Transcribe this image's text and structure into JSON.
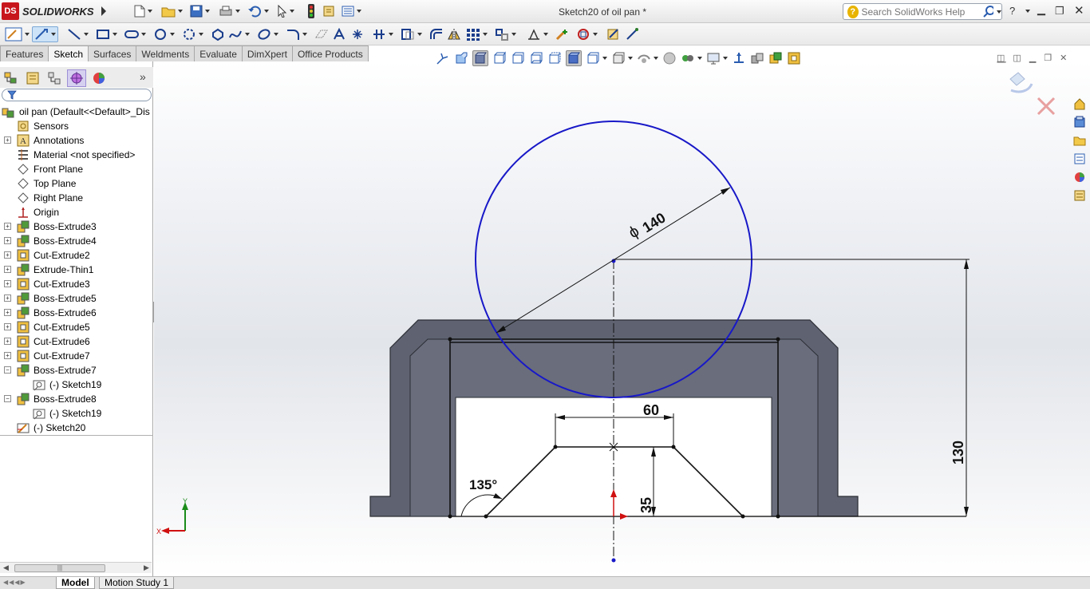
{
  "app": {
    "brand": "SOLIDWORKS",
    "logo_text": "DS"
  },
  "document": {
    "title": "Sketch20 of oil pan *"
  },
  "search": {
    "placeholder": "Search SolidWorks Help"
  },
  "tabs": [
    {
      "label": "Features",
      "active": false
    },
    {
      "label": "Sketch",
      "active": true
    },
    {
      "label": "Surfaces",
      "active": false
    },
    {
      "label": "Weldments",
      "active": false
    },
    {
      "label": "Evaluate",
      "active": false
    },
    {
      "label": "DimXpert",
      "active": false
    },
    {
      "label": "Office Products",
      "active": false
    }
  ],
  "tree": {
    "root": "oil pan  (Default<<Default>_Dis",
    "items": [
      {
        "label": "Sensors",
        "icon": "sensor-icon",
        "expandable": false,
        "level": 1
      },
      {
        "label": "Annotations",
        "icon": "annotations-icon",
        "expandable": true,
        "level": 1
      },
      {
        "label": "Material <not specified>",
        "icon": "material-icon",
        "expandable": false,
        "level": 1
      },
      {
        "label": "Front Plane",
        "icon": "plane-icon",
        "expandable": false,
        "level": 1
      },
      {
        "label": "Top Plane",
        "icon": "plane-icon",
        "expandable": false,
        "level": 1
      },
      {
        "label": "Right Plane",
        "icon": "plane-icon",
        "expandable": false,
        "level": 1
      },
      {
        "label": "Origin",
        "icon": "origin-icon",
        "expandable": false,
        "level": 1
      },
      {
        "label": "Boss-Extrude3",
        "icon": "boss-extrude-icon",
        "expandable": true,
        "level": 1
      },
      {
        "label": "Boss-Extrude4",
        "icon": "boss-extrude-icon",
        "expandable": true,
        "level": 1
      },
      {
        "label": "Cut-Extrude2",
        "icon": "cut-extrude-icon",
        "expandable": true,
        "level": 1
      },
      {
        "label": "Extrude-Thin1",
        "icon": "boss-extrude-icon",
        "expandable": true,
        "level": 1
      },
      {
        "label": "Cut-Extrude3",
        "icon": "cut-extrude-icon",
        "expandable": true,
        "level": 1
      },
      {
        "label": "Boss-Extrude5",
        "icon": "boss-extrude-icon",
        "expandable": true,
        "level": 1
      },
      {
        "label": "Boss-Extrude6",
        "icon": "boss-extrude-icon",
        "expandable": true,
        "level": 1
      },
      {
        "label": "Cut-Extrude5",
        "icon": "cut-extrude-icon",
        "expandable": true,
        "level": 1
      },
      {
        "label": "Cut-Extrude6",
        "icon": "cut-extrude-icon",
        "expandable": true,
        "level": 1
      },
      {
        "label": "Cut-Extrude7",
        "icon": "cut-extrude-icon",
        "expandable": true,
        "level": 1
      },
      {
        "label": "Boss-Extrude7",
        "icon": "boss-extrude-icon",
        "expandable": "open",
        "level": 1
      },
      {
        "label": "(-) Sketch19",
        "icon": "sketch-icon",
        "expandable": false,
        "level": 2
      },
      {
        "label": "Boss-Extrude8",
        "icon": "boss-extrude-icon",
        "expandable": "open",
        "level": 1
      },
      {
        "label": "(-) Sketch19",
        "icon": "sketch-icon",
        "expandable": false,
        "level": 2
      },
      {
        "label": "(-) Sketch20",
        "icon": "active-sketch-icon",
        "expandable": false,
        "level": 1
      }
    ]
  },
  "sketch": {
    "dim_diameter": "140",
    "dim_width": "60",
    "dim_height": "35",
    "dim_overall": "130",
    "dim_angle": "135°",
    "diameter_symbol": "ϕ"
  },
  "triad": {
    "x_label": "X",
    "y_label": "Y"
  },
  "bottom_tabs": [
    {
      "label": "Model",
      "active": true
    },
    {
      "label": "Motion Study 1",
      "active": false
    }
  ],
  "colors": {
    "sketch_blue": "#1818c8",
    "body_gray": "#5e6270",
    "body_light": "#6a6e7d",
    "accent_red": "#d01010"
  }
}
